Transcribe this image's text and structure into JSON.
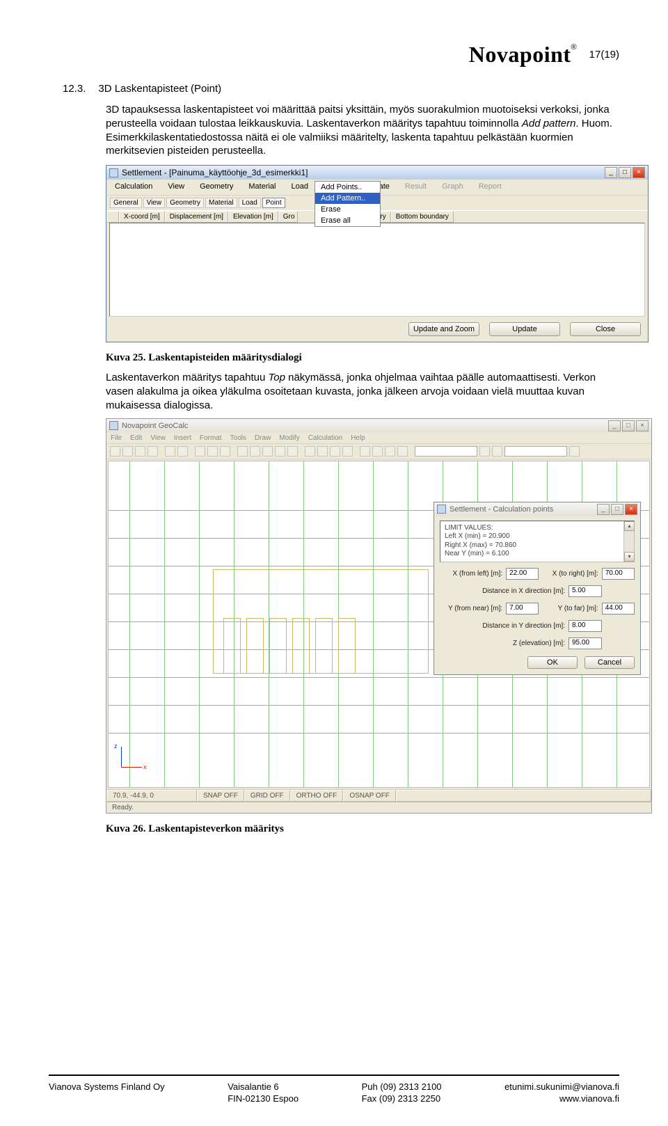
{
  "header": {
    "logo_text": "Novapoint",
    "reg": "®",
    "page_no": "17(19)"
  },
  "section": {
    "number": "12.3.",
    "title": "3D Laskentapisteet (Point)"
  },
  "para1a": "3D tapauksessa laskentapisteet voi määrittää paitsi yksittäin, myös suorakulmion muotoiseksi verkoksi, jonka perusteella voidaan tulostaa leikkauskuvia. Laskentaverkon määritys tapahtuu toiminnolla ",
  "para1b": "Add pattern",
  "para1c": ". Huom. Esimerkkilaskentatiedostossa näitä ei ole valmiiksi määritelty, laskenta tapahtuu pelkästään kuormien merkitsevien pisteiden perusteella.",
  "win1": {
    "title": "Settlement - [Painuma_käyttöohje_3d_esimerkki1]",
    "menu": [
      "Calculation",
      "View",
      "Geometry",
      "Material",
      "Load",
      "Point",
      "Calculate",
      "Result",
      "Graph",
      "Report"
    ],
    "tabs": [
      "General",
      "View",
      "Geometry",
      "Material",
      "Load",
      "Point"
    ],
    "cols": [
      "X-coord [m]",
      "Displacement [m]",
      "Elevation [m]",
      "Gro"
    ],
    "cols2": [
      "ndary",
      "Bottom boundary"
    ],
    "dropdown": [
      "Add Points..",
      "Add Pattern..",
      "Erase",
      "Erase all"
    ],
    "dropdown_hi": 1,
    "btns": [
      "Update and Zoom",
      "Update",
      "Close"
    ]
  },
  "caption25": "Kuva 25. Laskentapisteiden määritysdialogi",
  "para2a": "Laskentaverkon määritys tapahtuu ",
  "para2b": "Top",
  "para2c": " näkymässä, jonka ohjelmaa vaihtaa päälle automaattisesti. Verkon vasen alakulma ja oikea yläkulma osoitetaan kuvasta, jonka jälkeen arvoja voidaan vielä muuttaa kuvan mukaisessa dialogissa.",
  "gc": {
    "title": "Novapoint GeoCalc",
    "menu": [
      "File",
      "Edit",
      "View",
      "Insert",
      "Format",
      "Tools",
      "Draw",
      "Modify",
      "Calculation",
      "Help"
    ],
    "status": {
      "coords": "70.9, -44.9, 0",
      "items": [
        "SNAP OFF",
        "GRID OFF",
        "ORTHO OFF",
        "OSNAP OFF"
      ],
      "ready": "Ready."
    }
  },
  "cp": {
    "title": "Settlement - Calculation points",
    "lim_head": "LIMIT VALUES:",
    "lim1": "Left  X (min) = 20.900",
    "lim2": "Right X (max) = 70.860",
    "lim3": "Near  Y (min) = 6.100",
    "x_from_lbl": "X (from left) [m]:",
    "x_from": "22.00",
    "x_to_lbl": "X (to right) [m]:",
    "x_to": "70.00",
    "distx_lbl": "Distance in X direction  [m]:",
    "distx": "5.00",
    "y_from_lbl": "Y (from near) [m]:",
    "y_from": "7.00",
    "y_to_lbl": "Y (to far) [m]:",
    "y_to": "44.00",
    "disty_lbl": "Distance in Y direction  [m]:",
    "disty": "8.00",
    "z_lbl": "Z (elevation) [m]:",
    "z": "95.00",
    "ok": "OK",
    "cancel": "Cancel"
  },
  "caption26": "Kuva 26. Laskentapisteverkon määritys",
  "footer": {
    "c1a": "Vianova Systems Finland Oy",
    "c2a": "Vaisalantie 6",
    "c2b": "FIN-02130 Espoo",
    "c3a": "Puh  (09) 2313 2100",
    "c3b": "Fax  (09) 2313 2250",
    "c4a": "etunimi.sukunimi@vianova.fi",
    "c4b": "www.vianova.fi"
  }
}
